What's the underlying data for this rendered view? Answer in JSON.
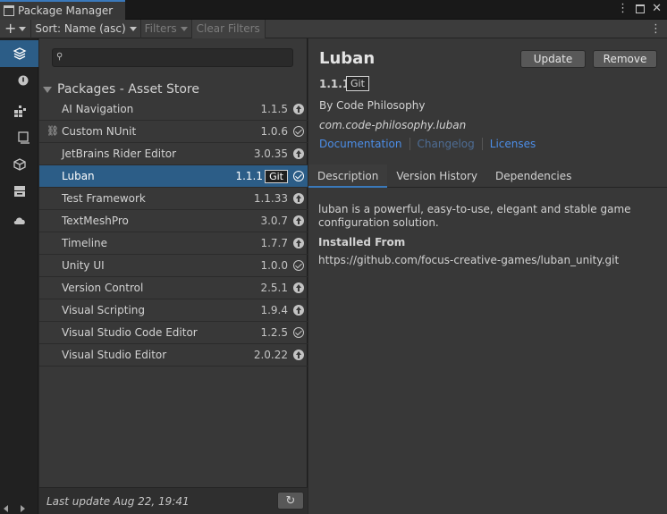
{
  "window": {
    "title": "Package Manager",
    "controls": [
      "more-options",
      "maximize",
      "close"
    ]
  },
  "toolbar": {
    "add_label": "+",
    "sort_label": "Sort: Name (asc)",
    "filters_label": "Filters",
    "clear_filters_label": "Clear Filters",
    "more_label": "⋮"
  },
  "sidebar": {
    "items": [
      {
        "icon": "layers-icon",
        "active": true
      },
      {
        "icon": "circle-info-icon",
        "active": false
      },
      {
        "icon": "grid-puzzle-icon",
        "active": false
      },
      {
        "icon": "monitor-icon",
        "active": false
      },
      {
        "icon": "cube-icon",
        "active": false
      },
      {
        "icon": "archive-icon",
        "active": false
      },
      {
        "icon": "cloud-icon",
        "active": false
      }
    ]
  },
  "search": {
    "placeholder": ""
  },
  "list": {
    "group_title": "Packages - Asset Store",
    "packages": [
      {
        "name": "AI Navigation",
        "version": "1.1.5",
        "status": "update",
        "linked": false,
        "selected": false,
        "git": ""
      },
      {
        "name": "Custom NUnit",
        "version": "1.0.6",
        "status": "installed",
        "linked": true,
        "selected": false,
        "git": ""
      },
      {
        "name": "JetBrains Rider Editor",
        "version": "3.0.35",
        "status": "update",
        "linked": false,
        "selected": false,
        "git": ""
      },
      {
        "name": "Luban",
        "version": "1.1.1",
        "status": "installed",
        "linked": false,
        "selected": true,
        "git": "Git"
      },
      {
        "name": "Test Framework",
        "version": "1.1.33",
        "status": "update",
        "linked": false,
        "selected": false,
        "git": ""
      },
      {
        "name": "TextMeshPro",
        "version": "3.0.7",
        "status": "update",
        "linked": false,
        "selected": false,
        "git": ""
      },
      {
        "name": "Timeline",
        "version": "1.7.7",
        "status": "update",
        "linked": false,
        "selected": false,
        "git": ""
      },
      {
        "name": "Unity UI",
        "version": "1.0.0",
        "status": "installed",
        "linked": false,
        "selected": false,
        "git": ""
      },
      {
        "name": "Version Control",
        "version": "2.5.1",
        "status": "update",
        "linked": false,
        "selected": false,
        "git": ""
      },
      {
        "name": "Visual Scripting",
        "version": "1.9.4",
        "status": "update",
        "linked": false,
        "selected": false,
        "git": ""
      },
      {
        "name": "Visual Studio Code Editor",
        "version": "1.2.5",
        "status": "installed",
        "linked": false,
        "selected": false,
        "git": ""
      },
      {
        "name": "Visual Studio Editor",
        "version": "2.0.22",
        "status": "update",
        "linked": false,
        "selected": false,
        "git": ""
      }
    ],
    "footer_text": "Last update Aug 22, 19:41"
  },
  "detail": {
    "title": "Luban",
    "update_label": "Update",
    "remove_label": "Remove",
    "version": "1.1.1",
    "git_badge": "Git",
    "author": "By Code Philosophy",
    "package_id": "com.code-philosophy.luban",
    "links": [
      {
        "label": "Documentation",
        "enabled": true
      },
      {
        "label": "Changelog",
        "enabled": false
      },
      {
        "label": "Licenses",
        "enabled": true
      }
    ],
    "tabs": [
      {
        "label": "Description",
        "active": true
      },
      {
        "label": "Version History",
        "active": false
      },
      {
        "label": "Dependencies",
        "active": false
      }
    ],
    "description": "luban is a powerful, easy-to-use, elegant and stable game configuration solution.",
    "installed_from_label": "Installed From",
    "installed_from_url": "https://github.com/focus-creative-games/luban_unity.git"
  },
  "colors": {
    "accent": "#2c5d87",
    "tab_highlight": "#3a79bb",
    "link": "#4c8ee8",
    "panel_bg": "#383838"
  }
}
